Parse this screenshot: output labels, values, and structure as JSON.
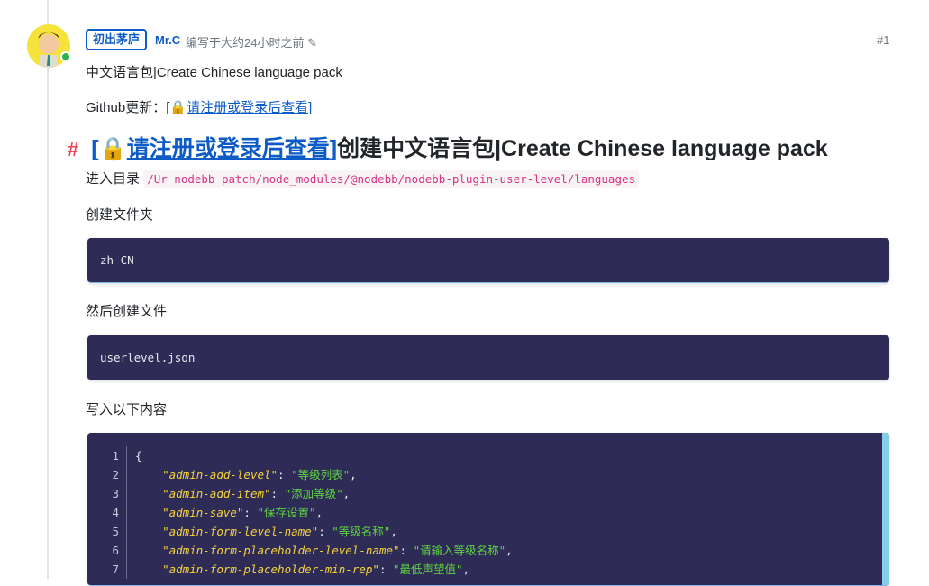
{
  "post": {
    "badge": "初出茅庐",
    "author": "Mr.C",
    "meta": "编写于大约24小时之前",
    "index": "#1"
  },
  "content": {
    "title_line": "中文语言包|Create Chinese language pack",
    "github_prefix": "Github更新：[",
    "locked_link": "请注册或登录后查看",
    "github_suffix": "]",
    "heading_open": "[",
    "heading_close": "]",
    "heading_text": "创建中文语言包|Create Chinese language pack",
    "enter_dir": "进入目录",
    "dir_path": "/Ur nodebb patch/node_modules/@nodebb/nodebb-plugin-user-level/languages",
    "create_folder": "创建文件夹",
    "folder_code": "zh-CN",
    "then_create": "然后创建文件",
    "file_code": "userlevel.json",
    "write_below": "写入以下内容"
  },
  "json_code": [
    {
      "n": "1",
      "text": "{"
    },
    {
      "n": "2",
      "key": "\"admin-add-level\"",
      "val": "\"等级列表\""
    },
    {
      "n": "3",
      "key": "\"admin-add-item\"",
      "val": "\"添加等级\""
    },
    {
      "n": "4",
      "key": "\"admin-save\"",
      "val": "\"保存设置\""
    },
    {
      "n": "5",
      "key": "\"admin-form-level-name\"",
      "val": "\"等级名称\""
    },
    {
      "n": "6",
      "key": "\"admin-form-placeholder-level-name\"",
      "val": "\"请输入等级名称\""
    },
    {
      "n": "7",
      "key": "\"admin-form-placeholder-min-rep\"",
      "val": "\"最低声望值\""
    }
  ]
}
